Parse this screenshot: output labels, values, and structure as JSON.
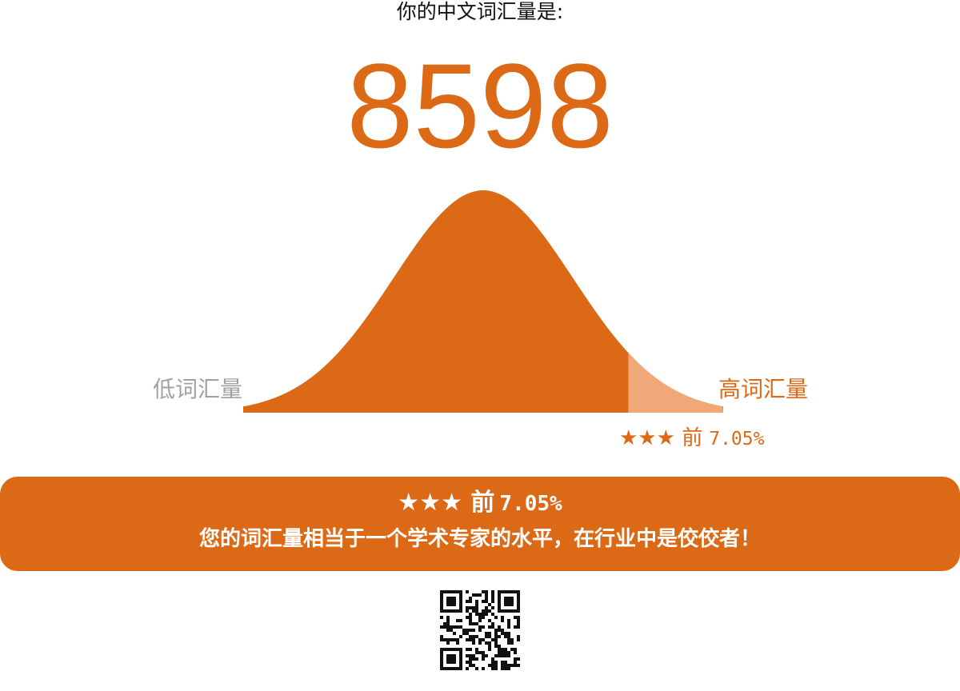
{
  "header": {
    "prompt": "你的中文词汇量是:",
    "vocab_count": "8598"
  },
  "distribution": {
    "low_label": "低词汇量",
    "high_label": "高词汇量",
    "user_percentile_fraction": 0.0705
  },
  "rank": {
    "stars": "★★★",
    "prefix": "前",
    "percent": "7.05%"
  },
  "banner": {
    "stars": "★★★",
    "prefix": "前",
    "percent": "7.05%",
    "description": "您的词汇量相当于一个学术专家的水平，在行业中是佼佼者！"
  },
  "qr_code": {
    "label": "qr-code"
  },
  "colors": {
    "accent": "#dc6915",
    "accent_light": "#f0a878",
    "muted_text": "#a1a1a1",
    "banner_text": "#ffffff"
  }
}
